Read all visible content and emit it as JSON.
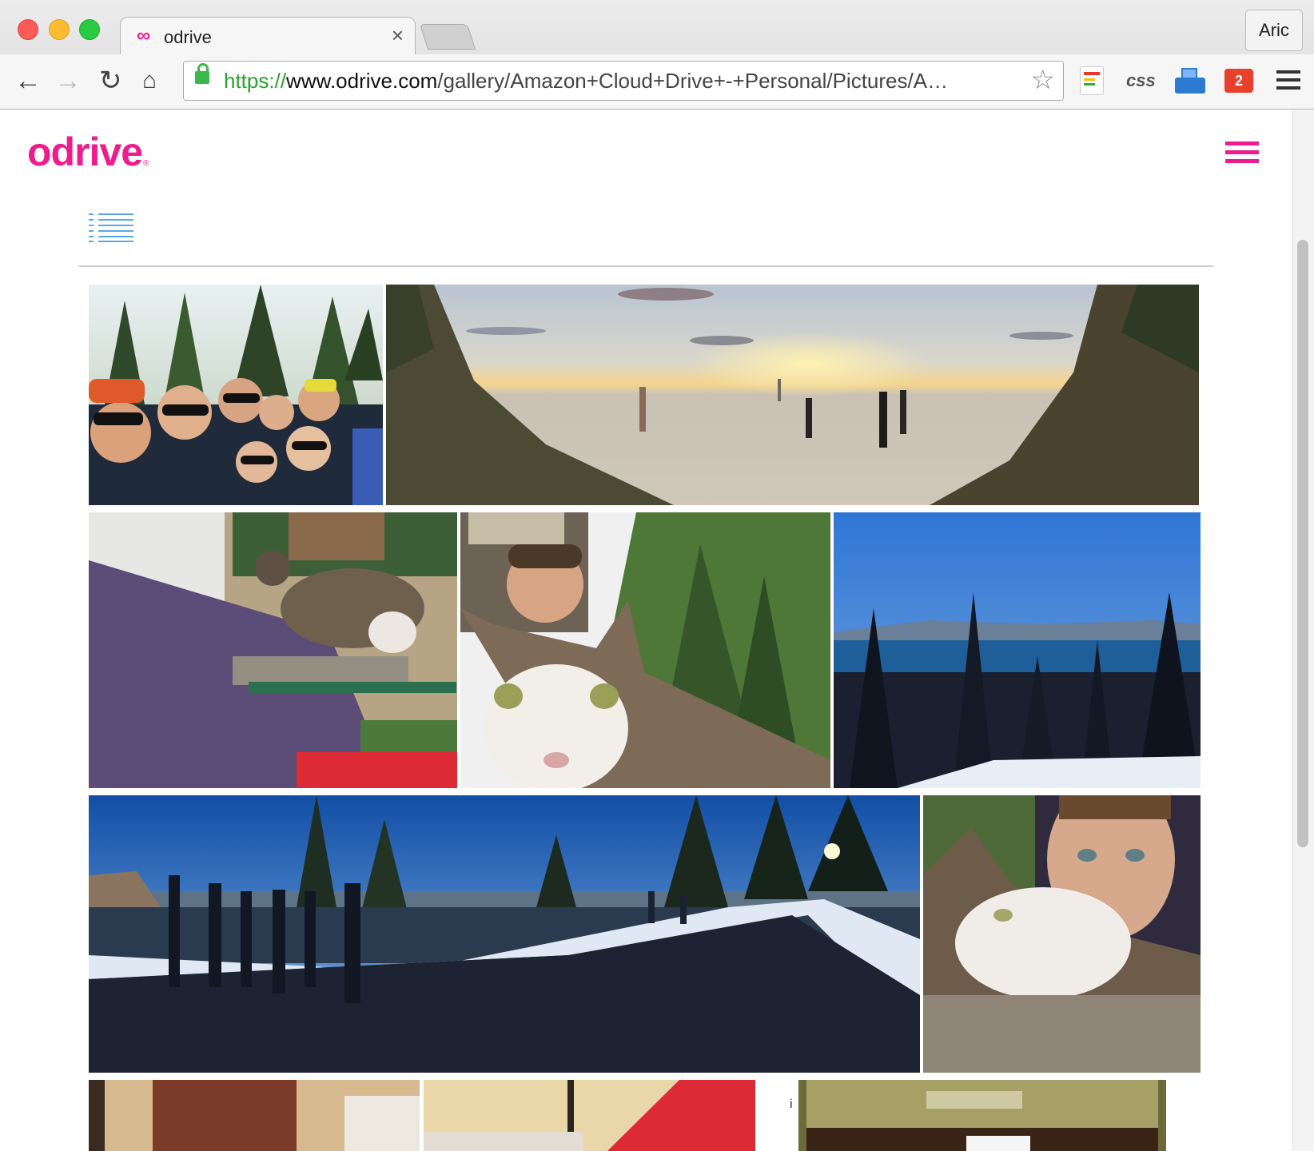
{
  "browser": {
    "tab_icon": "∞",
    "tab_title": "odrive",
    "tab_close": "×",
    "profile_name": "Aric",
    "url_scheme": "https://",
    "url_host": "www.odrive.com",
    "url_path": "/gallery/Amazon+Cloud+Drive+-+Personal/Pictures/A…",
    "ext_css_label": "css",
    "ext_badge_count": "2",
    "ext_star": "☆"
  },
  "site": {
    "logo_text": "odrive",
    "logo_mark": "®",
    "accent_color": "#ee1c8c"
  },
  "gallery": {
    "view_toggle_icon": "list-view-icon",
    "stray_char": "i",
    "photos": [
      {
        "subject": "group-selfie-forest"
      },
      {
        "subject": "beach-sunset-panorama"
      },
      {
        "subject": "petting-cat-on-bench"
      },
      {
        "subject": "man-cat-selfie-trees"
      },
      {
        "subject": "lake-tahoe-view"
      },
      {
        "subject": "group-road-panorama"
      },
      {
        "subject": "man-with-cat-closeup"
      },
      {
        "subject": "fireplace-room"
      },
      {
        "subject": "lamp-red-shirt"
      },
      {
        "subject": "framed-sign"
      }
    ]
  }
}
